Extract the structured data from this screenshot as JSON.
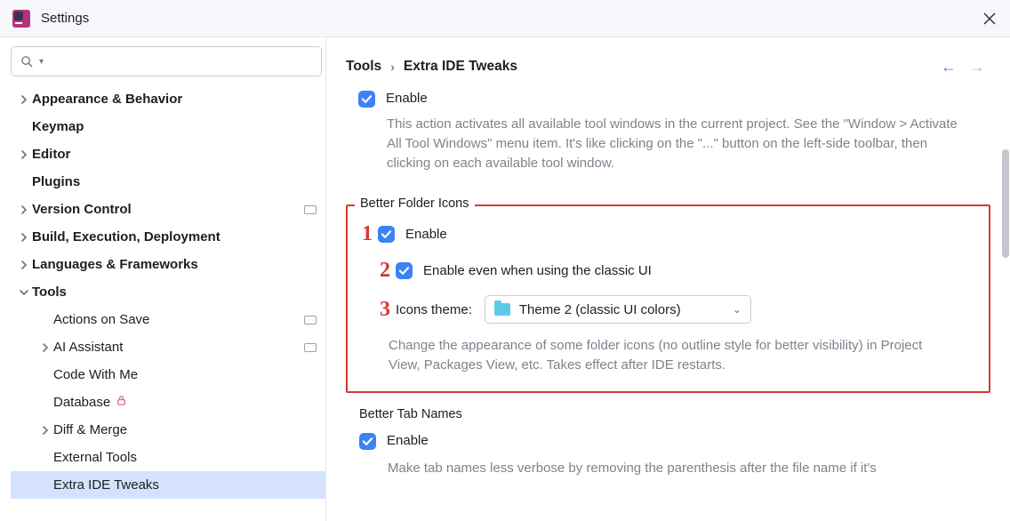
{
  "window": {
    "title": "Settings"
  },
  "breadcrumb": {
    "root": "Tools",
    "leaf": "Extra IDE Tweaks"
  },
  "sidebar": {
    "items": [
      {
        "label": "Appearance & Behavior",
        "depth": 0,
        "expandable": true,
        "expanded": false
      },
      {
        "label": "Keymap",
        "depth": 0,
        "expandable": false
      },
      {
        "label": "Editor",
        "depth": 0,
        "expandable": true,
        "expanded": false
      },
      {
        "label": "Plugins",
        "depth": 0,
        "expandable": false
      },
      {
        "label": "Version Control",
        "depth": 0,
        "expandable": true,
        "expanded": false,
        "badge": true
      },
      {
        "label": "Build, Execution, Deployment",
        "depth": 0,
        "expandable": true,
        "expanded": false
      },
      {
        "label": "Languages & Frameworks",
        "depth": 0,
        "expandable": true,
        "expanded": false
      },
      {
        "label": "Tools",
        "depth": 0,
        "expandable": true,
        "expanded": true
      },
      {
        "label": "Actions on Save",
        "depth": 1,
        "expandable": false,
        "badge": true
      },
      {
        "label": "AI Assistant",
        "depth": 1,
        "expandable": true,
        "expanded": false,
        "badge": true
      },
      {
        "label": "Code With Me",
        "depth": 1,
        "expandable": false
      },
      {
        "label": "Database",
        "depth": 1,
        "expandable": false,
        "lock": true
      },
      {
        "label": "Diff & Merge",
        "depth": 1,
        "expandable": true,
        "expanded": false
      },
      {
        "label": "External Tools",
        "depth": 1,
        "expandable": false
      },
      {
        "label": "Extra IDE Tweaks",
        "depth": 1,
        "expandable": false,
        "selected": true
      }
    ]
  },
  "section_top": {
    "enable_label": "Enable",
    "description": "This action activates all available tool windows in the current project. See the \"Window > Activate All Tool Windows\" menu item. It's like clicking on the \"...\" button on the left-side toolbar, then clicking on each available tool window."
  },
  "group_folder": {
    "title": "Better Folder Icons",
    "enable_label": "Enable",
    "classic_label": "Enable even when using the classic UI",
    "icons_theme_label": "Icons theme:",
    "selected_theme": "Theme 2 (classic UI colors)",
    "description": "Change the appearance of some folder icons (no outline style for better visibility) in Project View, Packages View, etc. Takes effect after IDE restarts.",
    "annot1": "1",
    "annot2": "2",
    "annot3": "3"
  },
  "group_tabs": {
    "title": "Better Tab Names",
    "enable_label": "Enable",
    "description": "Make tab names less verbose by removing the parenthesis after the file name if it's"
  }
}
